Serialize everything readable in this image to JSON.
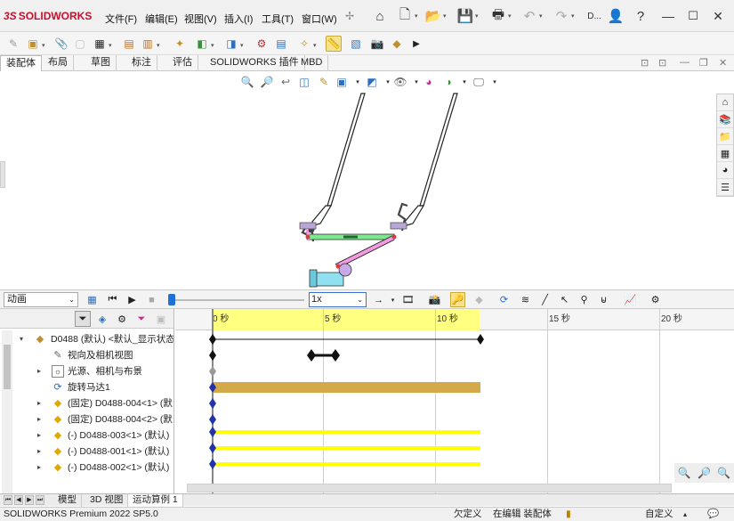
{
  "app": {
    "logo_prefix": "3S",
    "logo_name": "SOLIDWORKS",
    "user_label": "D...",
    "help_icon": "question-icon"
  },
  "menu": [
    {
      "label": "文件(F)"
    },
    {
      "label": "编辑(E)"
    },
    {
      "label": "视图(V)"
    },
    {
      "label": "插入(I)"
    },
    {
      "label": "工具(T)"
    },
    {
      "label": "窗口(W)"
    }
  ],
  "tabs": [
    {
      "label": "装配体",
      "active": true
    },
    {
      "label": "布局"
    },
    {
      "label": "草图"
    },
    {
      "label": "标注"
    },
    {
      "label": "评估"
    },
    {
      "label": "SOLIDWORKS 插件"
    },
    {
      "label": "MBD"
    }
  ],
  "motion": {
    "study_type": "动画",
    "playback_speed": "1x",
    "timeline_ticks": [
      {
        "label": "0 秒"
      },
      {
        "label": "5 秒"
      },
      {
        "label": "10 秒"
      },
      {
        "label": "15 秒"
      },
      {
        "label": "20 秒"
      }
    ]
  },
  "tree": {
    "rows": [
      {
        "label": "D0488 (默认) <默认_显示状态",
        "expander": "▾",
        "icon": "assembly-icon"
      },
      {
        "label": "视向及相机视图",
        "expander": "",
        "icon": "camera-view-icon"
      },
      {
        "label": "光源、相机与布景",
        "expander": "▸",
        "icon": "lights-icon"
      },
      {
        "label": "旋转马达1",
        "expander": "",
        "icon": "rotary-motor-icon"
      },
      {
        "label": "(固定) D0488-004<1> (默",
        "expander": "▸",
        "icon": "part-icon"
      },
      {
        "label": "(固定) D0488-004<2> (默",
        "expander": "▸",
        "icon": "part-icon"
      },
      {
        "label": "(-) D0488-003<1> (默认)",
        "expander": "▸",
        "icon": "part-icon"
      },
      {
        "label": "(-) D0488-001<1> (默认)",
        "expander": "▸",
        "icon": "part-icon"
      },
      {
        "label": "(-) D0488-002<1> (默认)",
        "expander": "▸",
        "icon": "part-icon"
      }
    ]
  },
  "bottom_tabs": [
    {
      "label": "模型"
    },
    {
      "label": "3D 视图"
    },
    {
      "label": "运动算例 1",
      "active": true
    }
  ],
  "status": {
    "product": "SOLIDWORKS Premium 2022 SP5.0",
    "definition": "欠定义",
    "mode": "在编辑 装配体",
    "custom": "自定义"
  },
  "colors": {
    "brand": "#c8102e",
    "timeline_highlight": "#ffff80",
    "motor_bar": "#d4a94a",
    "component_bar": "#ffff00",
    "key_diamond": "#2233aa"
  }
}
